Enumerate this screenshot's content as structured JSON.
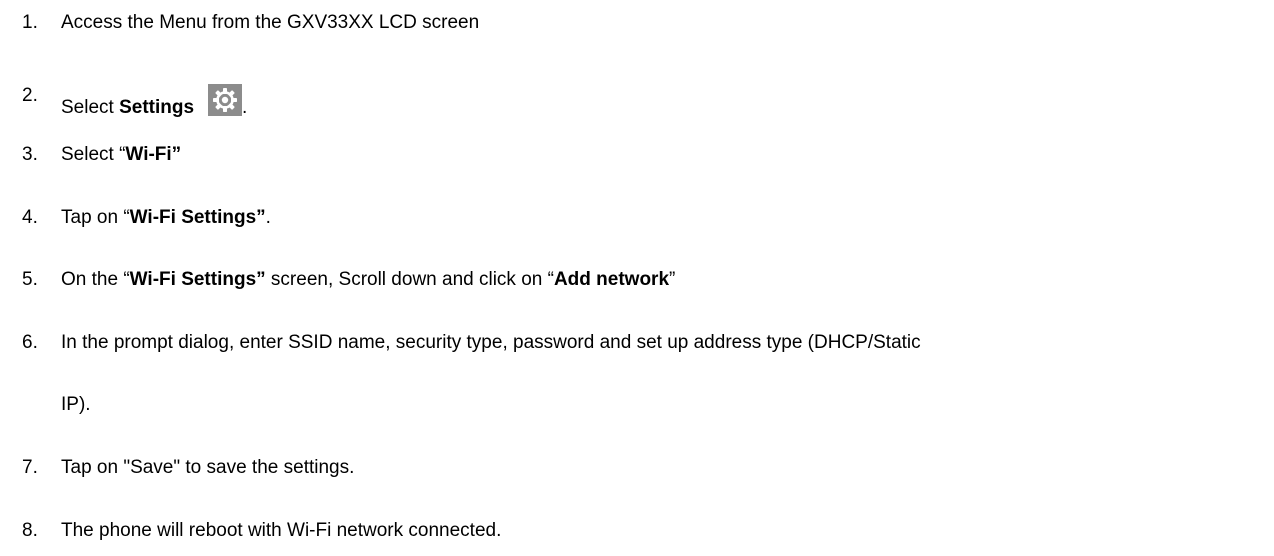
{
  "steps": [
    {
      "num": "1.",
      "text": "Access the Menu from the GXV33XX LCD screen"
    },
    {
      "num": "2.",
      "pre": "Select ",
      "bold": "Settings",
      "post": ".",
      "icon": "gear-icon"
    },
    {
      "num": "3.",
      "pre": "Select “",
      "bold": "Wi-Fi”"
    },
    {
      "num": "4.",
      "pre": "Tap on “",
      "bold": "Wi-Fi Settings”",
      "post": "."
    },
    {
      "num": "5.",
      "pre": "On the “",
      "bold": "Wi-Fi Settings”",
      "mid": " screen, Scroll down and click on “",
      "bold2": "Add network",
      "post": "”"
    },
    {
      "num": "6.",
      "text": "In the prompt dialog, enter SSID name, security type, password and set up address type (DHCP/Static",
      "text_cont": "IP)."
    },
    {
      "num": "7.",
      "text": "Tap on \"Save\" to save the settings."
    },
    {
      "num": "8.",
      "text": "The phone will reboot with Wi-Fi network connected."
    }
  ],
  "colors": {
    "text": "#000000",
    "icon_bg": "#8c8c8c",
    "icon_fg": "#ffffff"
  }
}
